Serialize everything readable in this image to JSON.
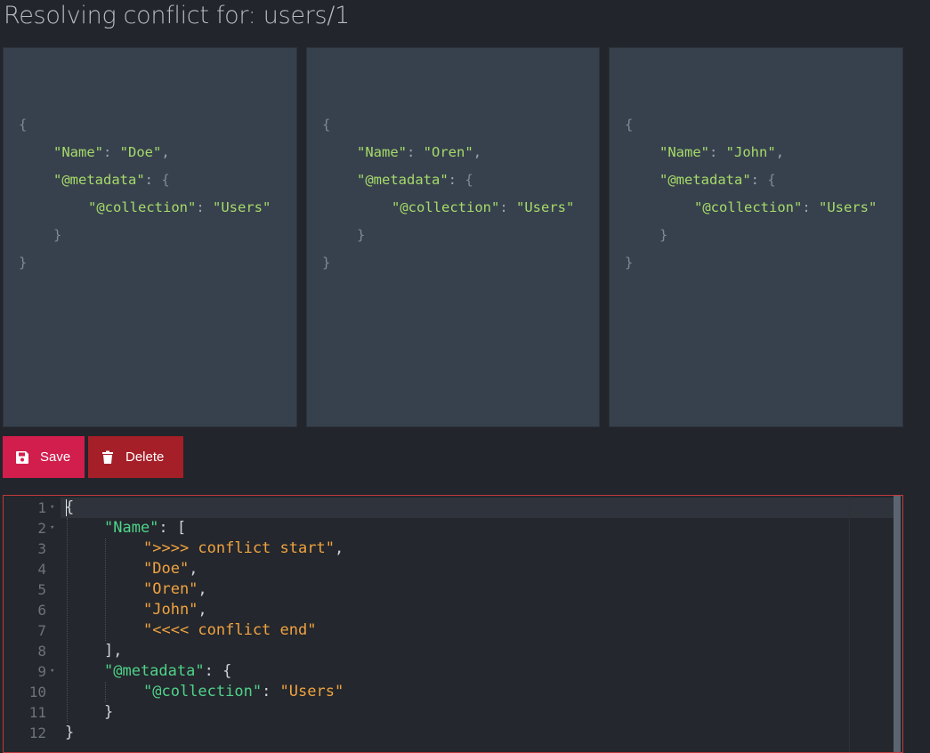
{
  "page": {
    "title": "Resolving conflict for: users/1"
  },
  "panels": [
    {
      "name": "Doe",
      "collection": "Users"
    },
    {
      "name": "Oren",
      "collection": "Users"
    },
    {
      "name": "John",
      "collection": "Users"
    }
  ],
  "json_tokens": {
    "open_brace": "{",
    "close_brace": "}",
    "name_key": "\"Name\"",
    "metadata_key": "\"@metadata\"",
    "collection_key": "\"@collection\"",
    "colon": ": ",
    "comma": ","
  },
  "toolbar": {
    "save_label": "Save",
    "save_icon": "floppy-disk-icon",
    "delete_label": "Delete",
    "delete_icon": "trash-icon",
    "save_color": "#d11e4d",
    "delete_color": "#a51f28"
  },
  "editor": {
    "line_numbers": [
      "1",
      "2",
      "3",
      "4",
      "5",
      "6",
      "7",
      "8",
      "9",
      "10",
      "11",
      "12"
    ],
    "lines": {
      "l1": "{",
      "l2_key": "\"Name\"",
      "l2_rest": ": [",
      "l3": "\">>>> conflict start\"",
      "l4": "\"Doe\"",
      "l5": "\"Oren\"",
      "l6": "\"John\"",
      "l7": "\"<<<< conflict end\"",
      "l8": "],",
      "l9_key": "\"@metadata\"",
      "l9_rest": ": {",
      "l10_key": "\"@collection\"",
      "l10_colon": ": ",
      "l10_val": "\"Users\"",
      "l11": "}",
      "l12": "}"
    },
    "key_color": "#4fd38a",
    "string_color": "#f0a340"
  }
}
